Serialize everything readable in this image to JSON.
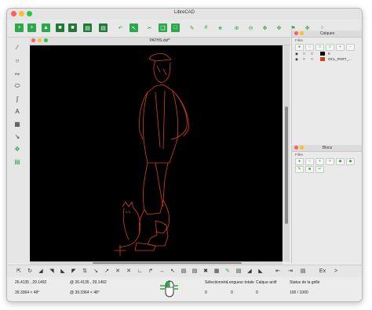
{
  "app": {
    "title": "LibreCAD"
  },
  "document": {
    "title": "PATHS.dxf*"
  },
  "layers_panel": {
    "title": "Calques",
    "filter_label": "Filtre",
    "layers": [
      {
        "name": "0",
        "color": "#000000"
      },
      {
        "name": "OCL_PART_...",
        "color": "#d04010"
      }
    ]
  },
  "blocks_panel": {
    "title": "Blocs",
    "filter_label": "Filtre"
  },
  "command_bar": {
    "ex_label": "Ex",
    "nav_label": ">"
  },
  "status_bar": {
    "abs_coords": "26.4135 , 29.1492",
    "rel_coords": "@ 26.4135 , 29.1492",
    "abs_polar": "39.3364 < 48°",
    "rel_polar": "@ 39.3364 < 48°",
    "selected_label": "Sélectionnés",
    "total_length_label": "Longueur totale",
    "selected_value": "0",
    "total_length_value": "0",
    "active_layer_label": "Calque actif",
    "active_layer_value": "0",
    "grid_status_label": "Status de la grille",
    "grid_status_value": "100 / 1000"
  },
  "colors": {
    "drawing_stroke": "#d8401c",
    "canvas": "#000000",
    "accent_green": "#2aa84a"
  }
}
